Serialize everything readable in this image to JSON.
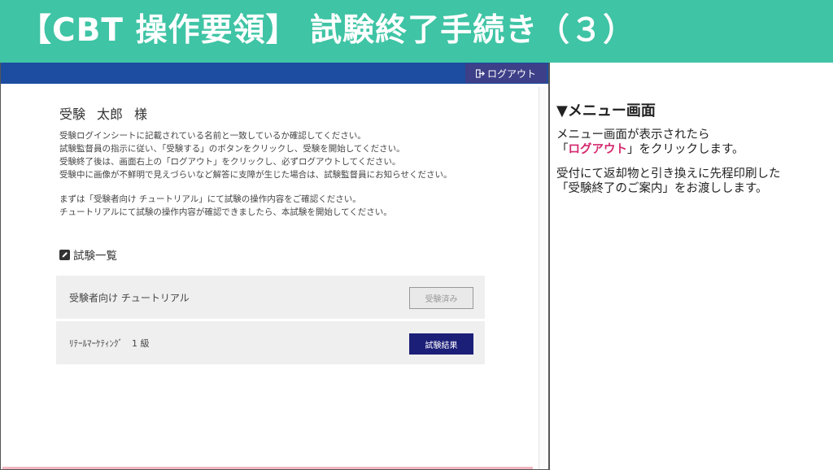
{
  "banner": {
    "title": "【CBT 操作要領】 試験終了手続き（３）"
  },
  "topbar": {
    "logout_label": "ログアウト",
    "logout_icon": "sign-out-icon"
  },
  "user": {
    "last_name": "受験",
    "first_name": "太郎",
    "honorific": "様"
  },
  "instructions": [
    "受験ログインシートに記載されている名前と一致しているか確認してください。",
    "試験監督員の指示に従い、「受験する」のボタンをクリックし、受験を開始してください。",
    "受験終了後は、画面右上の「ログアウト」をクリックし、必ずログアウトしてください。",
    "受験中に画像が不鮮明で見えづらいなど解答に支障が生じた場合は、試験監督員にお知らせください。",
    "まずは「受験者向け チュートリアル」にて試験の操作内容をご確認ください。",
    "チュートリアルにて試験の操作内容が確認できましたら、本試験を開始してください。"
  ],
  "exam_list": {
    "heading": "試験一覧",
    "heading_icon": "edit-icon",
    "items": [
      {
        "name": "受験者向け チュートリアル",
        "button": "受験済み"
      },
      {
        "name": "ﾘﾃｰﾙﾏｰｹﾃｨﾝｸﾞ　1 級",
        "button": "試験結果"
      }
    ]
  },
  "side": {
    "title": "▼メニュー画面",
    "line1": "メニュー画面が表示されたら",
    "line2_open": "「",
    "line2_highlight": "ログアウト",
    "line2_close": "」をクリックします。",
    "line3": "受付にて返却物と引き換えに先程印刷した",
    "line4": "「受験終了のご案内」をお渡しします。",
    "highlight_color": "#d42a6e"
  },
  "colors": {
    "banner": "#3fc4a5",
    "topbar": "#1c4da0",
    "logout_button": "#3d3f88",
    "result_button": "#1c1f78"
  }
}
